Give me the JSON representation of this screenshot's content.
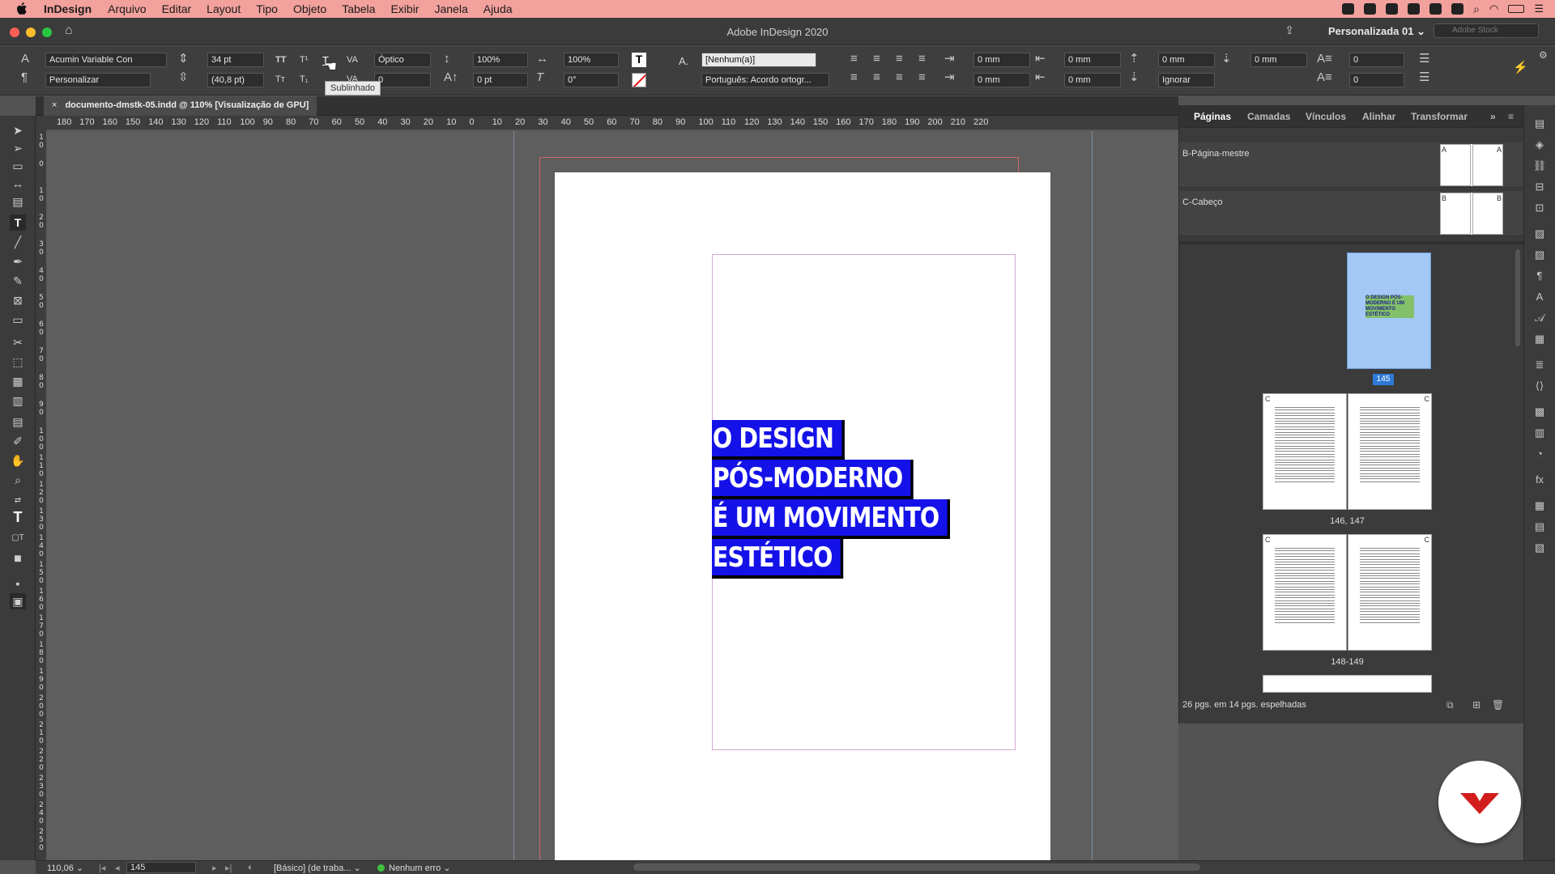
{
  "menubar": {
    "app_name": "InDesign",
    "items": [
      "Arquivo",
      "Editar",
      "Layout",
      "Tipo",
      "Objeto",
      "Tabela",
      "Exibir",
      "Janela",
      "Ajuda"
    ]
  },
  "window": {
    "title": "Adobe InDesign 2020",
    "workspace": "Personalizada 01",
    "stock_placeholder": "Adobe Stock"
  },
  "control": {
    "font_family": "Acumin Variable Con",
    "font_style": "Personalizar",
    "font_size": "34 pt",
    "leading": "(40,8 pt)",
    "kerning": "Óptico",
    "tracking": "0",
    "vscale": "100%",
    "hscale": "100%",
    "baseline": "0 pt",
    "skew": "0°",
    "char_style": "[Nenhum(a)]",
    "language": "Português: Acordo ortogr...",
    "indent_left": "0 mm",
    "indent_first": "0 mm",
    "indent_right": "0 mm",
    "indent_last": "0 mm",
    "space_before": "0 mm",
    "space_after": "0 mm",
    "drop_lines": "0",
    "drop_chars": "0",
    "grid_align": "Ignorar",
    "tooltip": "Sublinhado",
    "tt_label": "TT",
    "tsup_label": "T¹",
    "tt_small": "Tт",
    "tsub_label": "T₁",
    "va_label": "VA",
    "char_color_label": "T",
    "char_style_icon": "A."
  },
  "document": {
    "tab_title": "documento-dmstk-05.indd @ 110% [Visualização de GPU]",
    "text_lines": [
      "O DESIGN",
      "PÓS-MODERNO",
      "É UM MOVIMENTO",
      "ESTÉTICO"
    ]
  },
  "rulers": {
    "horizontal": [
      "180",
      "170",
      "160",
      "150",
      "140",
      "130",
      "120",
      "110",
      "100",
      "90",
      "80",
      "70",
      "60",
      "50",
      "40",
      "30",
      "20",
      "10",
      "0",
      "10",
      "20",
      "30",
      "40",
      "50",
      "60",
      "70",
      "80",
      "90",
      "100",
      "110",
      "120",
      "130",
      "140",
      "150",
      "160",
      "170",
      "180",
      "190",
      "200",
      "210",
      "220"
    ],
    "vertical": [
      "10",
      "0",
      "10",
      "20",
      "30",
      "40",
      "50",
      "60",
      "70",
      "80",
      "90",
      "100",
      "110",
      "120",
      "130",
      "140",
      "150",
      "160",
      "170",
      "180",
      "190",
      "200",
      "210",
      "220",
      "230",
      "240",
      "250"
    ]
  },
  "pages_panel": {
    "tabs": [
      "Páginas",
      "Camadas",
      "Vínculos",
      "Alinhar",
      "Transformar"
    ],
    "masters": [
      {
        "name": "B-Página-mestre",
        "letter": "A"
      },
      {
        "name": "C-Cabeço",
        "letter": "B"
      }
    ],
    "current_page_text": "O DESIGN PÓS-MODERNO É UM MOVIMENTO ESTÉTICO",
    "current_page": "145",
    "spreads": [
      "146, 147",
      "148-149"
    ],
    "spread_letter": "C",
    "status": "26 pgs. em 14 pgs. espelhadas"
  },
  "statusbar": {
    "zoom": "110,06",
    "page": "145",
    "profile": "[Básico] (de traba...",
    "preflight": "Nenhum erro"
  },
  "colors": {
    "menubar_bg": "#f2a19c",
    "highlight": "#1412e8",
    "current_page_bg": "#a3c8f5",
    "logo_red": "#d21d1d"
  }
}
